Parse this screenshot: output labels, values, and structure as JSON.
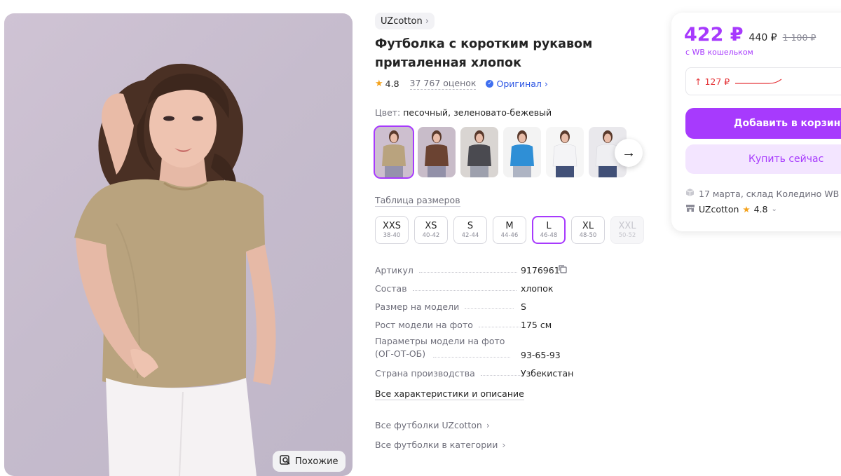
{
  "brand": {
    "name": "UZcotton"
  },
  "product": {
    "title": "Футболка с коротким рукавом приталенная хлопок",
    "rating": "4.8",
    "reviews": "37 767 оценок",
    "original_label": "Оригинал",
    "color_key": "Цвет:",
    "color_value": "песочный, зеленовато-бежевый"
  },
  "thumbnails": [
    {
      "name": "sand",
      "color": "#b9a37e",
      "selected": true
    },
    {
      "name": "brown",
      "color": "#6b4332",
      "selected": false
    },
    {
      "name": "graphite",
      "color": "#4a4a50",
      "selected": false
    },
    {
      "name": "blue",
      "color": "#2f8fd6",
      "selected": false
    },
    {
      "name": "white",
      "color": "#f4f4f6",
      "selected": false
    },
    {
      "name": "white-2",
      "color": "#efeff2",
      "selected": false
    }
  ],
  "size_table_label": "Таблица размеров",
  "sizes": [
    {
      "size": "XXS",
      "range": "38-40",
      "state": "normal"
    },
    {
      "size": "XS",
      "range": "40-42",
      "state": "normal"
    },
    {
      "size": "S",
      "range": "42-44",
      "state": "normal"
    },
    {
      "size": "M",
      "range": "44-46",
      "state": "normal"
    },
    {
      "size": "L",
      "range": "46-48",
      "state": "selected"
    },
    {
      "size": "XL",
      "range": "48-50",
      "state": "normal"
    },
    {
      "size": "XXL",
      "range": "50-52",
      "state": "disabled"
    }
  ],
  "specs": [
    {
      "key": "Артикул",
      "value": "9176961"
    },
    {
      "key": "Состав",
      "value": "хлопок"
    },
    {
      "key": "Размер на модели",
      "value": "S"
    },
    {
      "key": "Рост модели на фото",
      "value": "175 см"
    },
    {
      "key": "Параметры модели на фото (ОГ-ОТ-ОБ)",
      "value": "93-65-93"
    },
    {
      "key": "Страна производства",
      "value": "Узбекистан"
    }
  ],
  "links": {
    "all_specs": "Все характеристики и описание",
    "all_brand": "Все футболки UZcotton",
    "all_category": "Все футболки в категории"
  },
  "similar_label": "Похожие",
  "price": {
    "current": "422 ₽",
    "old": "440 ₽",
    "original": "1 100 ₽",
    "wallet_label": "с WB кошельком",
    "trend": "↑ 127 ₽",
    "accent_color": "#a73afd",
    "trend_color": "#e5363a"
  },
  "actions": {
    "add_to_cart": "Добавить в корзину",
    "buy_now": "Купить сейчас"
  },
  "delivery": {
    "text": "17 марта, склад Коледино WB"
  },
  "seller": {
    "name": "UZcotton",
    "rating": "4.8"
  }
}
